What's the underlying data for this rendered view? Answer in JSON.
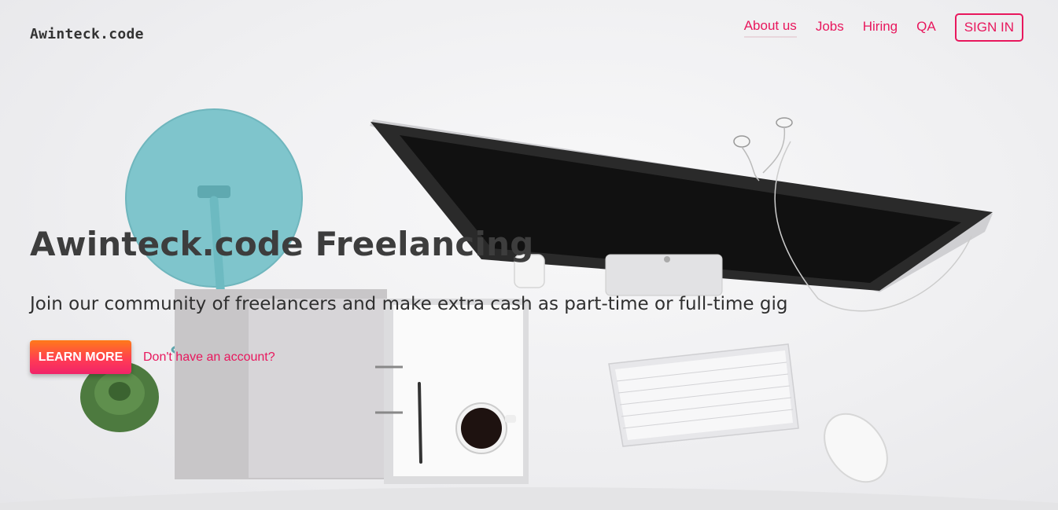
{
  "brand": {
    "logo_text": "Awinteck.code",
    "accent_color": "#e8175d"
  },
  "nav": {
    "items": [
      {
        "label": "About us",
        "active": true
      },
      {
        "label": "Jobs"
      },
      {
        "label": "Hiring"
      },
      {
        "label": "QA"
      }
    ],
    "signin_label": "SIGN IN"
  },
  "hero": {
    "title": "Awinteck.code Freelancing",
    "subtitle": "Join our community of freelancers and make extra cash as part-time or full-time gig",
    "cta_label": "LEARN MORE",
    "account_link": "Don't have an account?"
  },
  "background": {
    "icons": [
      "desk-lamp-icon",
      "monitor-icon",
      "earphones-icon",
      "keyboard-icon",
      "mouse-icon",
      "notebook-icon",
      "coffee-cup-icon",
      "pen-icon",
      "plant-icon"
    ]
  }
}
